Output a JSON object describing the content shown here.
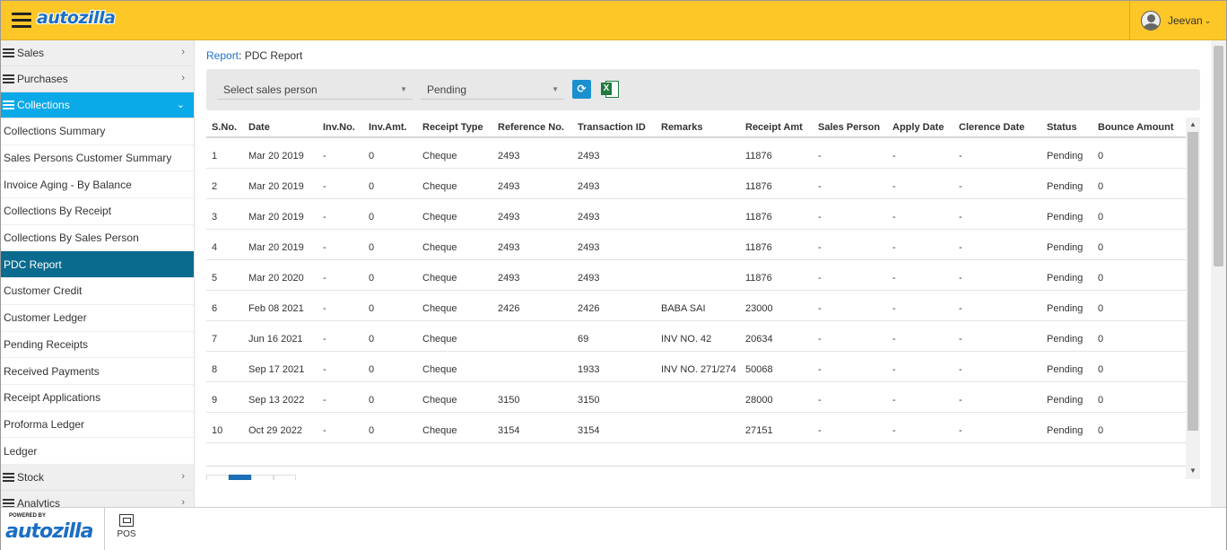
{
  "header": {
    "brand": "autozilla",
    "user": "Jeevan"
  },
  "sidebar": {
    "groups_top": [
      {
        "label": "Sales"
      },
      {
        "label": "Purchases"
      }
    ],
    "active_group": {
      "label": "Collections"
    },
    "items": [
      {
        "label": "Collections Summary"
      },
      {
        "label": "Sales Persons Customer Summary"
      },
      {
        "label": "Invoice Aging - By Balance"
      },
      {
        "label": "Collections By Receipt"
      },
      {
        "label": "Collections By Sales Person"
      },
      {
        "label": "PDC Report"
      },
      {
        "label": "Customer Credit"
      },
      {
        "label": "Customer Ledger"
      },
      {
        "label": "Pending Receipts"
      },
      {
        "label": "Received Payments"
      },
      {
        "label": "Receipt Applications"
      },
      {
        "label": "Proforma Ledger"
      },
      {
        "label": "Ledger"
      }
    ],
    "groups_bottom": [
      {
        "label": "Stock"
      },
      {
        "label": "Analytics"
      }
    ]
  },
  "breadcrumb": {
    "link": "Report",
    "current": ": PDC Report"
  },
  "filters": {
    "sales_person": "Select sales person",
    "status": "Pending"
  },
  "table": {
    "columns": [
      "S.No.",
      "Date",
      "Inv.No.",
      "Inv.Amt.",
      "Receipt Type",
      "Reference No.",
      "Transaction ID",
      "Remarks",
      "Receipt Amt",
      "Sales Person",
      "Apply Date",
      "Clerence Date",
      "Status",
      "Bounce Amount"
    ],
    "rows": [
      [
        "1",
        "Mar 20 2019",
        "-",
        "0",
        "Cheque",
        "2493",
        "2493",
        "",
        "11876",
        "-",
        "-",
        "-",
        "Pending",
        "0"
      ],
      [
        "2",
        "Mar 20 2019",
        "-",
        "0",
        "Cheque",
        "2493",
        "2493",
        "",
        "11876",
        "-",
        "-",
        "-",
        "Pending",
        "0"
      ],
      [
        "3",
        "Mar 20 2019",
        "-",
        "0",
        "Cheque",
        "2493",
        "2493",
        "",
        "11876",
        "-",
        "-",
        "-",
        "Pending",
        "0"
      ],
      [
        "4",
        "Mar 20 2019",
        "-",
        "0",
        "Cheque",
        "2493",
        "2493",
        "",
        "11876",
        "-",
        "-",
        "-",
        "Pending",
        "0"
      ],
      [
        "5",
        "Mar 20 2020",
        "-",
        "0",
        "Cheque",
        "2493",
        "2493",
        "",
        "11876",
        "-",
        "-",
        "-",
        "Pending",
        "0"
      ],
      [
        "6",
        "Feb 08 2021",
        "-",
        "0",
        "Cheque",
        "2426",
        "2426",
        "BABA SAI",
        "23000",
        "-",
        "-",
        "-",
        "Pending",
        "0"
      ],
      [
        "7",
        "Jun 16 2021",
        "-",
        "0",
        "Cheque",
        "",
        "69",
        "INV NO. 42",
        "20634",
        "-",
        "-",
        "-",
        "Pending",
        "0"
      ],
      [
        "8",
        "Sep 17 2021",
        "-",
        "0",
        "Cheque",
        "",
        "1933",
        "INV NO. 271/274",
        "50068",
        "-",
        "-",
        "-",
        "Pending",
        "0"
      ],
      [
        "9",
        "Sep 13 2022",
        "-",
        "0",
        "Cheque",
        "3150",
        "3150",
        "",
        "28000",
        "-",
        "-",
        "-",
        "Pending",
        "0"
      ],
      [
        "10",
        "Oct 29 2022",
        "-",
        "0",
        "Cheque",
        "3154",
        "3154",
        "",
        "27151",
        "-",
        "-",
        "-",
        "Pending",
        "0"
      ]
    ]
  },
  "footer": {
    "powered": "POWERED BY",
    "brand": "autozilla",
    "pos_label": "POS"
  },
  "icons": {
    "menu": "hamburger-icon",
    "refresh": "refresh-icon",
    "excel": "excel-icon",
    "pos": "pos-icon"
  },
  "colors": {
    "header": "#fdc727",
    "active_group": "#0aa9e8",
    "active_item": "#0b6b8e",
    "link": "#1a73c8"
  }
}
